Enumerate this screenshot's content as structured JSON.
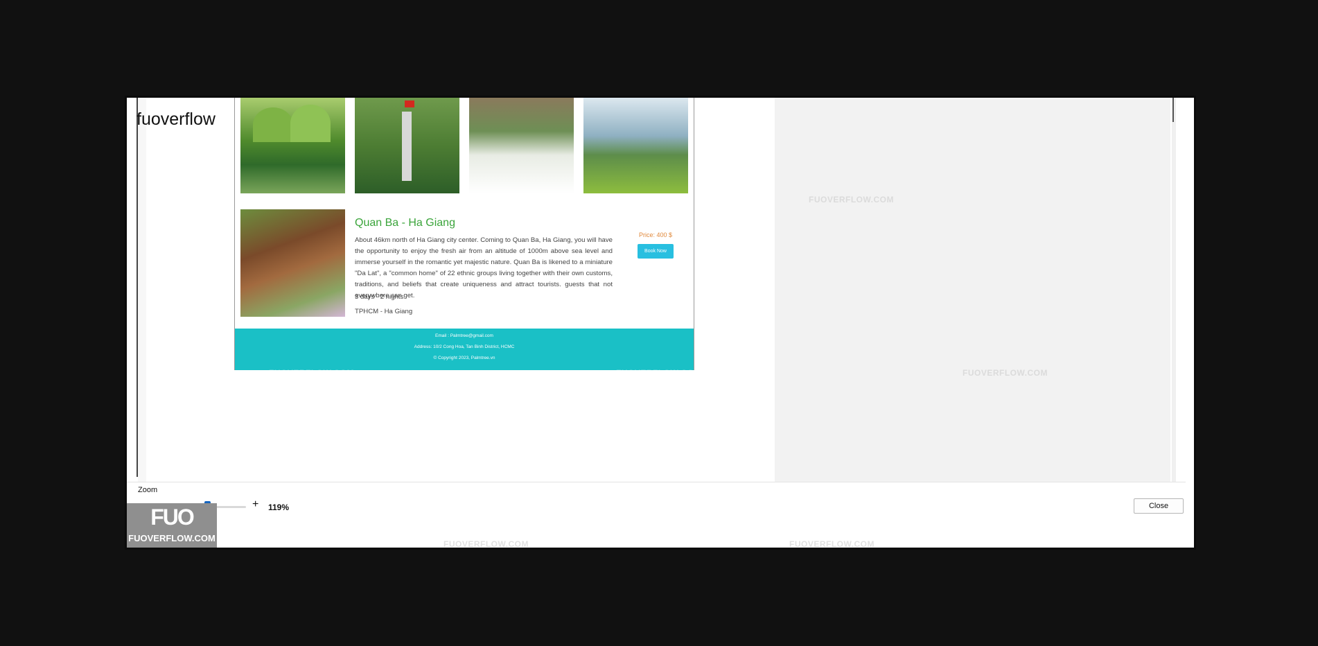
{
  "window": {
    "title": "fuoverflow"
  },
  "preview": {
    "tour": {
      "title": "Quan Ba - Ha Giang",
      "description": "About 46km north of Ha Giang city center. Coming to Quan Ba, Ha Giang, you will have the opportunity to enjoy the fresh air from an altitude of 1000m above sea level and immerse yourself in the romantic yet majestic nature. Quan Ba is likened to a miniature \"Da Lat\", a \"common home\" of 22 ethnic groups living together with their own customs, traditions, and beliefs that create uniqueness and attract tourists. guests that not everywhere can get.",
      "duration": "3 days - 2 nights",
      "route": "TPHCM - Ha Giang",
      "price": "Price:  400 $",
      "book_label": "Book Now"
    },
    "footer": {
      "email": "Email : Palmtree@gmail.com",
      "address": "Address: 10/2 Cong Hoa, Tan Binh District, HCMC",
      "copyright": "© Copyright 2023, Palmtree.vn"
    },
    "gallery_icons": [
      "mountain-photo-icon",
      "flag-tower-photo-icon",
      "children-flowers-photo-icon",
      "valley-road-photo-icon"
    ]
  },
  "watermark": {
    "text": "FUOVERFLOW.COM",
    "logo_mark": "FUO",
    "logo_text": "FUOVERFLOW.COM"
  },
  "zoom": {
    "label": "Zoom",
    "minus": "-",
    "plus": "+",
    "value": "119%",
    "slider_fraction": 0.6
  },
  "buttons": {
    "close": "Close"
  },
  "colors": {
    "accent": "#1565c0",
    "footer": "#1ac0c6",
    "title_green": "#3aa43a",
    "book_button": "#28bfe0"
  }
}
